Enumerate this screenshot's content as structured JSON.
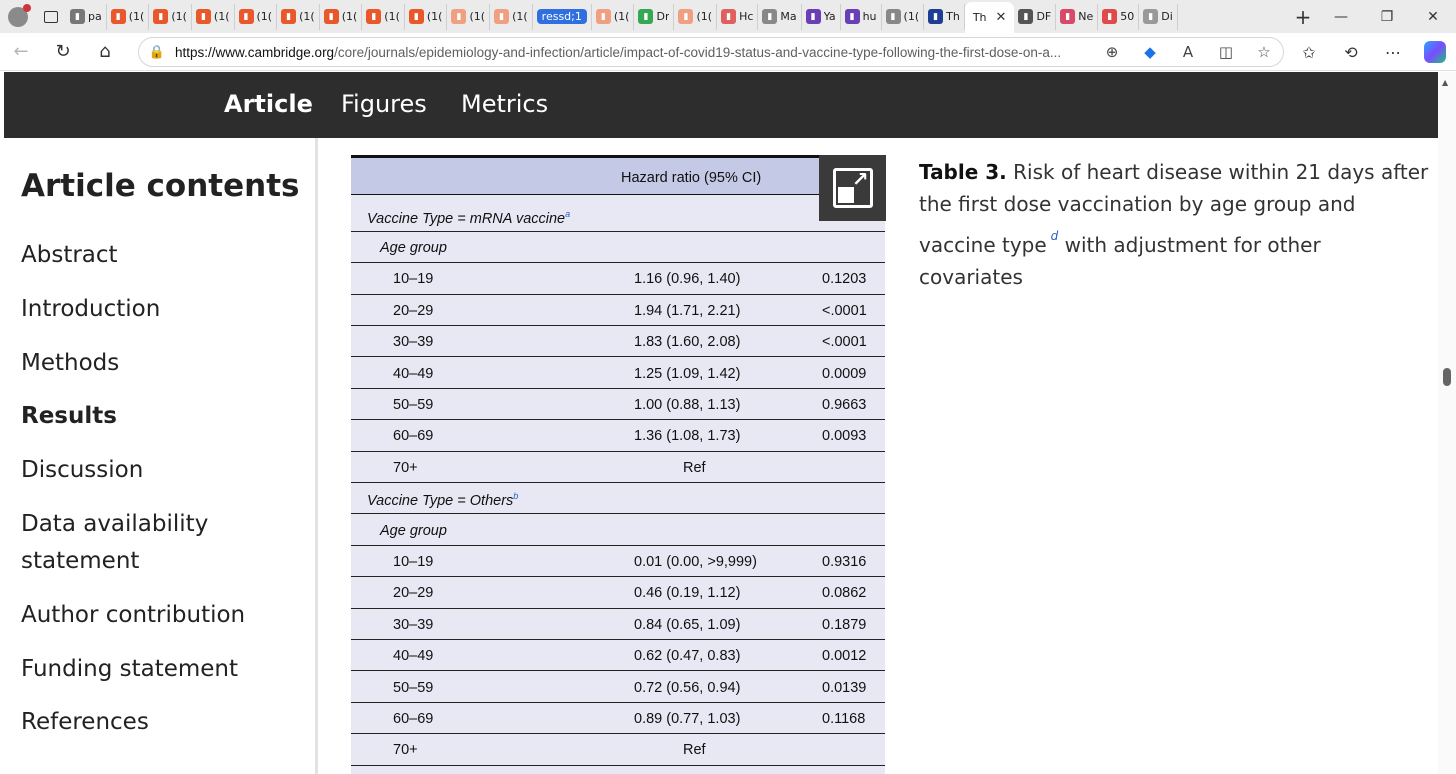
{
  "browser": {
    "tabs": [
      {
        "label": "pa",
        "color": "#777777"
      },
      {
        "label": "(1(",
        "color": "#e8582a"
      },
      {
        "label": "(1(",
        "color": "#e8582a"
      },
      {
        "label": "(1(",
        "color": "#e8582a"
      },
      {
        "label": "(1(",
        "color": "#e8582a"
      },
      {
        "label": "(1(",
        "color": "#e8582a"
      },
      {
        "label": "(1(",
        "color": "#e8582a"
      },
      {
        "label": "(1(",
        "color": "#e8582a"
      },
      {
        "label": "(1(",
        "color": "#e8582a"
      },
      {
        "label": "(1(",
        "color": "#f0a080"
      },
      {
        "label": "(1(",
        "color": "#f0a080"
      }
    ],
    "pill_label": "ressd;1",
    "tabs_after": [
      {
        "label": "(1(",
        "color": "#f0a080"
      },
      {
        "label": "Dr",
        "color": "#34a853"
      },
      {
        "label": "(1(",
        "color": "#f0a080"
      },
      {
        "label": "Hc",
        "color": "#e06060"
      },
      {
        "label": "Ma",
        "color": "#888888"
      },
      {
        "label": "Ya",
        "color": "#6a3fb5"
      },
      {
        "label": "hu",
        "color": "#6a3fb5"
      },
      {
        "label": "(1(",
        "color": "#888888"
      },
      {
        "label": "Th",
        "color": "#1c3f94"
      }
    ],
    "active_tab": "Th",
    "tabs_end": [
      {
        "label": "DF",
        "color": "#555555"
      },
      {
        "label": "Ne",
        "color": "#d84a6a"
      },
      {
        "label": "50",
        "color": "#e04a4a"
      },
      {
        "label": "Di",
        "color": "#999999"
      }
    ],
    "url_host": "https://www.cambridge.org",
    "url_path": "/core/journals/epidemiology-and-infection/article/impact-of-covid19-status-and-vaccine-type-following-the-first-dose-on-a..."
  },
  "site_nav": {
    "items": [
      "Article",
      "Figures",
      "Metrics"
    ]
  },
  "sidebar": {
    "title": "Article contents",
    "items": [
      "Abstract",
      "Introduction",
      "Methods",
      "Results",
      "Discussion",
      "Data availability statement",
      "Author contribution",
      "Funding statement",
      "References"
    ],
    "active": "Results"
  },
  "table": {
    "header": "Hazard ratio (95% CI)",
    "rows": [
      {
        "type": "section",
        "label": "Vaccine Type = mRNA vaccine",
        "note": "a"
      },
      {
        "type": "sub",
        "label": "Age group"
      },
      {
        "type": "data",
        "age": "10–19",
        "hr": "1.16 (0.96, 1.40)",
        "p": "0.1203"
      },
      {
        "type": "data",
        "age": "20–29",
        "hr": "1.94 (1.71, 2.21)",
        "p": "<.0001"
      },
      {
        "type": "data",
        "age": "30–39",
        "hr": "1.83 (1.60, 2.08)",
        "p": "<.0001"
      },
      {
        "type": "data",
        "age": "40–49",
        "hr": "1.25 (1.09, 1.42)",
        "p": "0.0009"
      },
      {
        "type": "data",
        "age": "50–59",
        "hr": "1.00 (0.88, 1.13)",
        "p": "0.9663"
      },
      {
        "type": "data",
        "age": "60–69",
        "hr": "1.36 (1.08, 1.73)",
        "p": "0.0093"
      },
      {
        "type": "ref",
        "age": "70+",
        "hr": "Ref"
      },
      {
        "type": "section",
        "label": "Vaccine Type = Others",
        "note": "b"
      },
      {
        "type": "sub",
        "label": "Age group"
      },
      {
        "type": "data",
        "age": "10–19",
        "hr": "0.01 (0.00, >9,999)",
        "p": "0.9316"
      },
      {
        "type": "data",
        "age": "20–29",
        "hr": "0.46 (0.19, 1.12)",
        "p": "0.0862"
      },
      {
        "type": "data",
        "age": "30–39",
        "hr": "0.84 (0.65, 1.09)",
        "p": "0.1879"
      },
      {
        "type": "data",
        "age": "40–49",
        "hr": "0.62 (0.47, 0.83)",
        "p": "0.0012"
      },
      {
        "type": "data",
        "age": "50–59",
        "hr": "0.72 (0.56, 0.94)",
        "p": "0.0139"
      },
      {
        "type": "data",
        "age": "60–69",
        "hr": "0.89 (0.77, 1.03)",
        "p": "0.1168"
      },
      {
        "type": "ref",
        "age": "70+",
        "hr": "Ref"
      }
    ]
  },
  "caption": {
    "label": "Table 3.",
    "text": "Risk of heart disease within 21 days after the first dose vaccination by age group and vaccine type",
    "note": "d",
    "text2": "with adjustment for other covariates"
  }
}
